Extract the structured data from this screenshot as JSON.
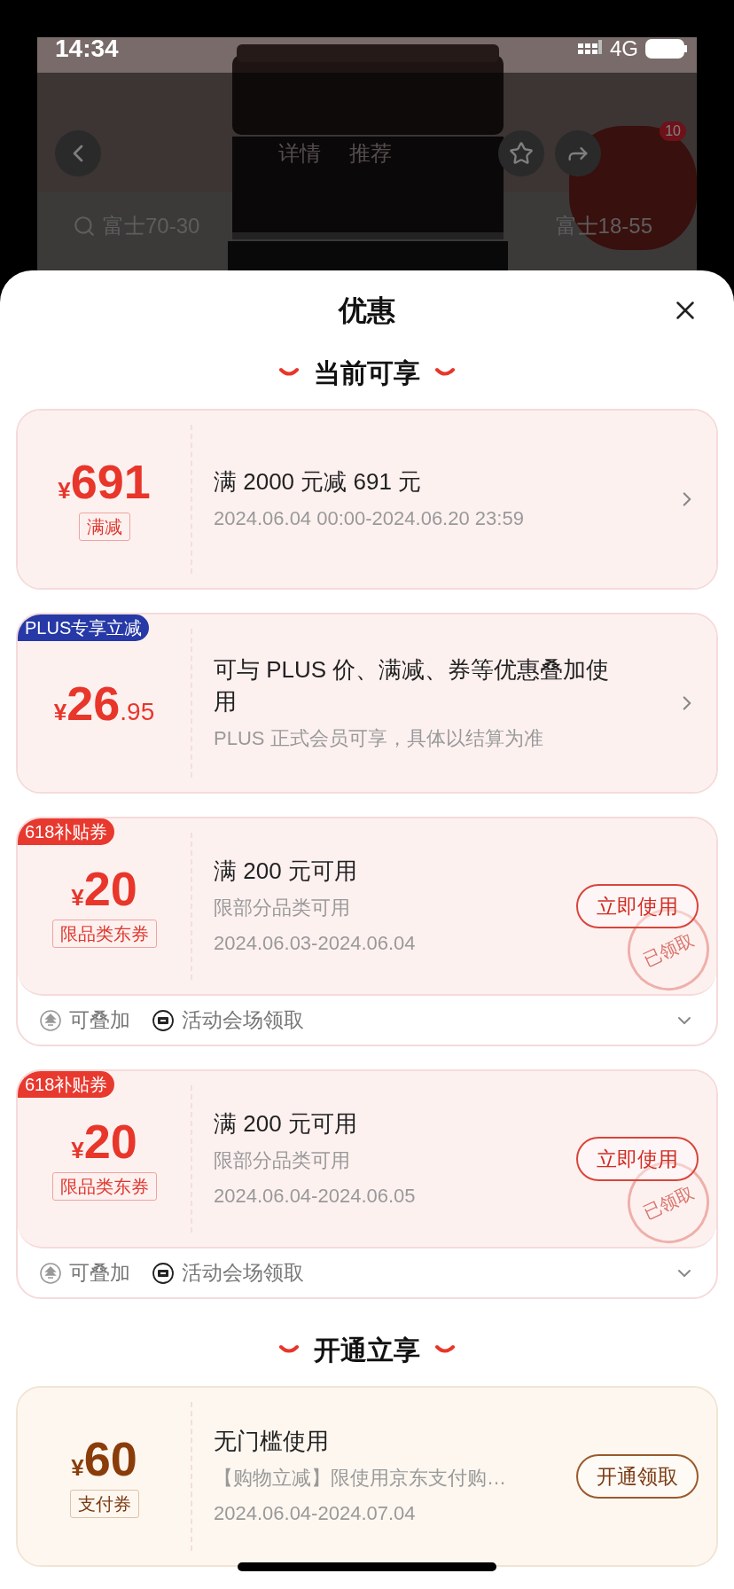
{
  "status_bar": {
    "time": "14:34",
    "network": "4G"
  },
  "background_page": {
    "tabs": [
      "详情",
      "推荐"
    ],
    "search_text": "富士70-30",
    "chip": "富士18-55",
    "cart_badge": "10"
  },
  "sheet": {
    "title": "优惠"
  },
  "sections": [
    {
      "title": "当前可享",
      "offers": [
        {
          "kind": "discount",
          "currency": "¥",
          "integer": "691",
          "label": "满减",
          "title": "满 2000 元减 691 元",
          "lines": [
            "2024.06.04 00:00-2024.06.20 23:59"
          ]
        },
        {
          "kind": "discount",
          "tag": {
            "text": "PLUS专享立减",
            "kind": "plus"
          },
          "currency": "¥",
          "integer": "26",
          "decimal": ".95",
          "title": "可与 PLUS 价、满减、券等优惠叠加使用",
          "lines": [
            "PLUS 正式会员可享，具体以结算为准"
          ]
        },
        {
          "kind": "coupon",
          "tag": {
            "text": "618补贴券",
            "kind": "subsidy"
          },
          "currency": "¥",
          "integer": "20",
          "label": "限品类东券",
          "title": "满 200 元可用",
          "lines": [
            "限部分品类可用",
            "2024.06.03-2024.06.04"
          ],
          "button": "立即使用",
          "stamp": "已领取",
          "footer": [
            "可叠加",
            "活动会场领取"
          ]
        },
        {
          "kind": "coupon",
          "tag": {
            "text": "618补贴券",
            "kind": "subsidy"
          },
          "currency": "¥",
          "integer": "20",
          "label": "限品类东券",
          "title": "满 200 元可用",
          "lines": [
            "限部分品类可用",
            "2024.06.04-2024.06.05"
          ],
          "button": "立即使用",
          "stamp": "已领取",
          "footer": [
            "可叠加",
            "活动会场领取"
          ]
        }
      ]
    },
    {
      "title": "开通立享",
      "offers": [
        {
          "kind": "payment_coupon",
          "currency": "¥",
          "integer": "60",
          "label": "支付券",
          "title": "无门槛使用",
          "lines": [
            "【购物立减】限使用京东支付购…",
            "2024.06.04-2024.07.04"
          ],
          "button": "开通领取"
        }
      ]
    }
  ]
}
